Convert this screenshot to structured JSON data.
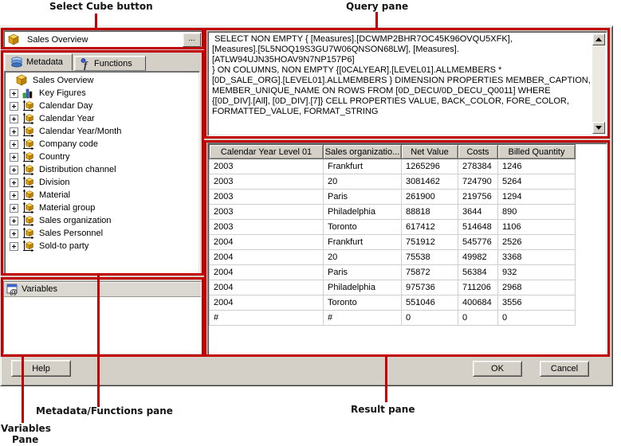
{
  "colors": {
    "annotation_red": "#c20000",
    "dialog_gray": "#d4d0c8"
  },
  "annotations": {
    "select_cube_label": "Select Cube button",
    "query_pane_label": "Query pane",
    "metadata_functions_label": "Metadata/Functions pane",
    "variables_label_line1": "Variables",
    "variables_label_line2": "Pane",
    "result_pane_label": "Result pane"
  },
  "cube_selector": {
    "value": "Sales Overview",
    "browse_button": "..."
  },
  "tabs": {
    "metadata": "Metadata",
    "functions": "Functions"
  },
  "tree": {
    "root": "Sales Overview",
    "items": [
      {
        "label": "Key Figures",
        "icon": "key-figures-icon"
      },
      {
        "label": "Calendar Day",
        "icon": "dimension-icon"
      },
      {
        "label": "Calendar Year",
        "icon": "dimension-icon"
      },
      {
        "label": "Calendar Year/Month",
        "icon": "dimension-icon"
      },
      {
        "label": "Company code",
        "icon": "dimension-icon"
      },
      {
        "label": "Country",
        "icon": "dimension-icon"
      },
      {
        "label": "Distribution channel",
        "icon": "dimension-icon"
      },
      {
        "label": "Division",
        "icon": "dimension-icon"
      },
      {
        "label": "Material",
        "icon": "dimension-icon"
      },
      {
        "label": "Material group",
        "icon": "dimension-icon"
      },
      {
        "label": "Sales organization",
        "icon": "dimension-icon"
      },
      {
        "label": "Sales Personnel",
        "icon": "dimension-icon"
      },
      {
        "label": "Sold-to party",
        "icon": "dimension-icon"
      }
    ]
  },
  "query": {
    "text": " SELECT NON EMPTY { [Measures].[DCWMP2BHR7OC45K96OVQU5XFK],\n[Measures].[5L5NOQ19S3GU7W06QNSON68LW], [Measures].[ATLW94UJN35HOAV9N7NP157P6]\n} ON COLUMNS, NON EMPTY {[0CALYEAR].[LEVEL01].ALLMEMBERS *\n[0D_SALE_ORG].[LEVEL01].ALLMEMBERS } DIMENSION PROPERTIES MEMBER_CAPTION,\nMEMBER_UNIQUE_NAME ON ROWS FROM [0D_DECU/0D_DECU_Q0011] WHERE\n{[0D_DIV].[All], [0D_DIV].[7]} CELL PROPERTIES VALUE, BACK_COLOR, FORE_COLOR,\nFORMATTED_VALUE, FORMAT_STRING"
  },
  "variables": {
    "title": "Variables"
  },
  "result_table": {
    "columns": [
      "Calendar Year Level 01",
      "Sales organizatio...",
      "Net Value",
      "Costs",
      "Billed Quantity"
    ],
    "rows": [
      [
        "2003",
        "Frankfurt",
        "1265296",
        "278384",
        "1246"
      ],
      [
        "2003",
        "20",
        "3081462",
        "724790",
        "5264"
      ],
      [
        "2003",
        "Paris",
        "261900",
        "219756",
        "1294"
      ],
      [
        "2003",
        "Philadelphia",
        "88818",
        "3644",
        "890"
      ],
      [
        "2003",
        "Toronto",
        "617412",
        "514648",
        "1106"
      ],
      [
        "2004",
        "Frankfurt",
        "751912",
        "545776",
        "2526"
      ],
      [
        "2004",
        "20",
        "75538",
        "49982",
        "3368"
      ],
      [
        "2004",
        "Paris",
        "75872",
        "56384",
        "932"
      ],
      [
        "2004",
        "Philadelphia",
        "975736",
        "711206",
        "2968"
      ],
      [
        "2004",
        "Toronto",
        "551046",
        "400684",
        "3556"
      ],
      [
        "#",
        "#",
        "0",
        "0",
        "0"
      ]
    ]
  },
  "buttons": {
    "help": "Help",
    "ok": "OK",
    "cancel": "Cancel"
  }
}
